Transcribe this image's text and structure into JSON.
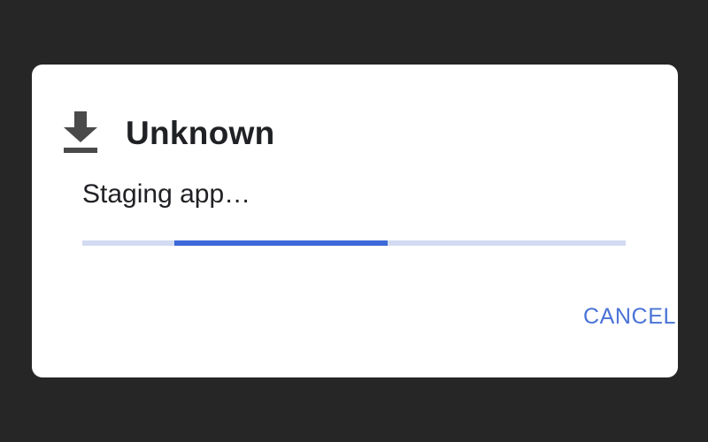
{
  "dialog": {
    "title": "Unknown",
    "title_icon": "download-icon",
    "status_text": "Staging app…",
    "progress": {
      "indeterminate": true,
      "visible_segment_start": 0.169,
      "visible_segment_end": 0.562
    },
    "cancel_label": "CANCEL"
  },
  "colors": {
    "backdrop": "#262626",
    "dialog_background": "#ffffff",
    "text_primary": "#202124",
    "accent": "#4a73d6",
    "progress_fill": "#3d6ad8",
    "progress_track": "#d2dbf1"
  }
}
